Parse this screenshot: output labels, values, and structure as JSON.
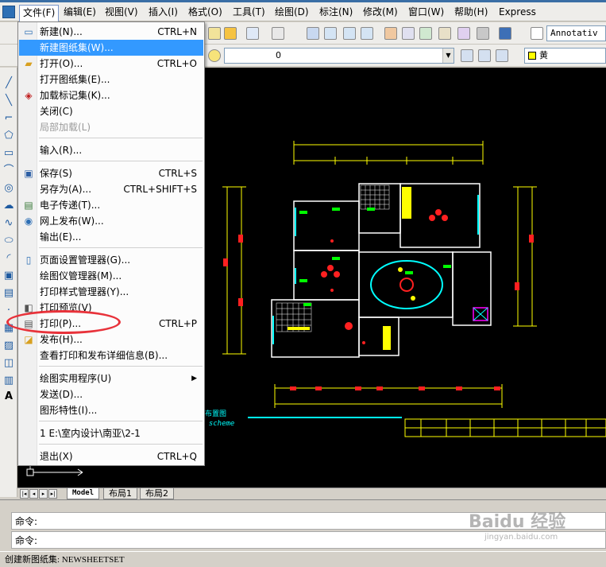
{
  "menubar": {
    "items": [
      "文件(F)",
      "编辑(E)",
      "视图(V)",
      "插入(I)",
      "格式(O)",
      "工具(T)",
      "绘图(D)",
      "标注(N)",
      "修改(M)",
      "窗口(W)",
      "帮助(H)",
      "Express"
    ]
  },
  "toolbar": {
    "style_combo": "Annotativ",
    "layer_combo": "0",
    "color_combo": "黄"
  },
  "file_menu": {
    "new": {
      "label": "新建(N)...",
      "shortcut": "CTRL+N"
    },
    "new_sheet_set": {
      "label": "新建图纸集(W)..."
    },
    "open": {
      "label": "打开(O)...",
      "shortcut": "CTRL+O"
    },
    "open_sheet_set": {
      "label": "打开图纸集(E)..."
    },
    "load_markup": {
      "label": "加载标记集(K)..."
    },
    "close": {
      "label": "关闭(C)"
    },
    "partial_load": {
      "label": "局部加载(L)"
    },
    "import": {
      "label": "输入(R)..."
    },
    "save": {
      "label": "保存(S)",
      "shortcut": "CTRL+S"
    },
    "save_as": {
      "label": "另存为(A)...",
      "shortcut": "CTRL+SHIFT+S"
    },
    "etransmit": {
      "label": "电子传递(T)..."
    },
    "publish_web": {
      "label": "网上发布(W)..."
    },
    "export": {
      "label": "输出(E)..."
    },
    "page_setup": {
      "label": "页面设置管理器(G)..."
    },
    "plotter_mgr": {
      "label": "绘图仪管理器(M)..."
    },
    "plot_style_mgr": {
      "label": "打印样式管理器(Y)..."
    },
    "plot_preview": {
      "label": "打印预览(V)"
    },
    "plot": {
      "label": "打印(P)...",
      "shortcut": "CTRL+P"
    },
    "publish": {
      "label": "发布(H)..."
    },
    "plot_details": {
      "label": "查看打印和发布详细信息(B)..."
    },
    "drawing_utilities": {
      "label": "绘图实用程序(U)"
    },
    "send": {
      "label": "发送(D)..."
    },
    "properties": {
      "label": "图形特性(I)..."
    },
    "recent_1": {
      "label": "1 E:\\室内设计\\南亚\\2-1"
    },
    "exit": {
      "label": "退出(X)",
      "shortcut": "CTRL+Q"
    }
  },
  "drawing": {
    "caption_1": "布置图",
    "caption_2": "n scheme"
  },
  "layout_tabs": [
    "Model",
    "布局1",
    "布局2"
  ],
  "command": {
    "line1": "命令:",
    "line2": "命令:"
  },
  "status": "创建新图纸集: NEWSHEETSET",
  "watermark": {
    "brand": "Baidu 经验",
    "url": "jingyan.baidu.com"
  },
  "colors": {
    "highlight": "#3399ff",
    "annotation": "#e8323a",
    "canvas": "#000000"
  }
}
